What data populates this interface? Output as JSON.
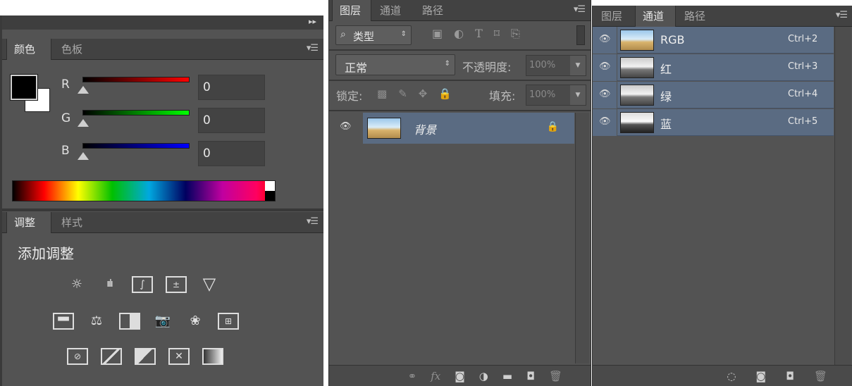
{
  "color_panel": {
    "tabs": [
      "颜色",
      "色板"
    ],
    "channels": [
      {
        "label": "R",
        "value": "0"
      },
      {
        "label": "G",
        "value": "0"
      },
      {
        "label": "B",
        "value": "0"
      }
    ]
  },
  "adjust_panel": {
    "tabs": [
      "调整",
      "样式"
    ],
    "title": "添加调整"
  },
  "layers_panel": {
    "tabs": [
      "图层",
      "通道",
      "路径"
    ],
    "filter_label": "类型",
    "blend_mode": "正常",
    "opacity_label": "不透明度:",
    "opacity_value": "100%",
    "lock_label": "锁定:",
    "fill_label": "填充:",
    "fill_value": "100%",
    "layer_name": "背景"
  },
  "channels_panel": {
    "tabs": [
      "图层",
      "通道",
      "路径"
    ],
    "channels": [
      {
        "name": "RGB",
        "shortcut": "Ctrl+2"
      },
      {
        "name": "红",
        "shortcut": "Ctrl+3"
      },
      {
        "name": "绿",
        "shortcut": "Ctrl+4"
      },
      {
        "name": "蓝",
        "shortcut": "Ctrl+5"
      }
    ]
  },
  "colors": {
    "panel_bg": "#535353",
    "selected_row": "#5a6b82"
  }
}
